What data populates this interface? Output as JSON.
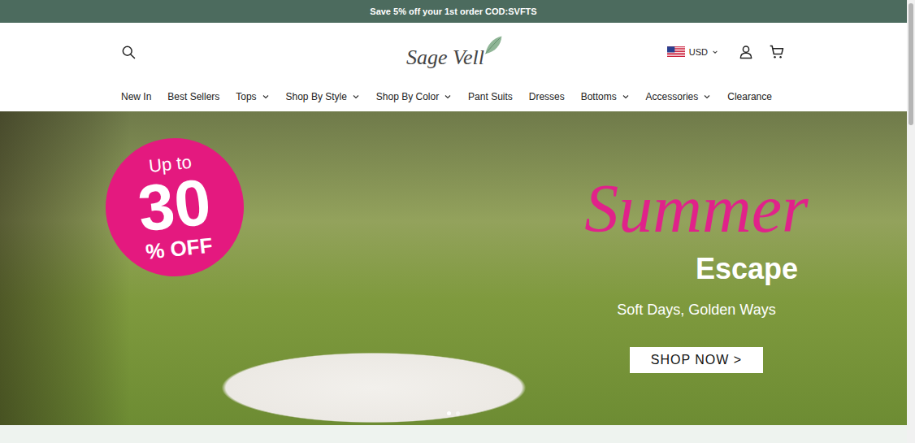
{
  "announcement": "Save 5% off your 1st order COD:SVFTS",
  "logo": {
    "text": "Sage Vell"
  },
  "currency": {
    "code": "USD"
  },
  "nav": [
    {
      "label": "New In",
      "dropdown": false
    },
    {
      "label": "Best Sellers",
      "dropdown": false
    },
    {
      "label": "Tops",
      "dropdown": true
    },
    {
      "label": "Shop By Style",
      "dropdown": true
    },
    {
      "label": "Shop By Color",
      "dropdown": true
    },
    {
      "label": "Pant Suits",
      "dropdown": false
    },
    {
      "label": "Dresses",
      "dropdown": false
    },
    {
      "label": "Bottoms",
      "dropdown": true
    },
    {
      "label": "Accessories",
      "dropdown": true
    },
    {
      "label": "Clearance",
      "dropdown": false
    }
  ],
  "hero": {
    "badge_top": "Up to",
    "badge_number": "30",
    "badge_bottom": "% OFF",
    "title": "Summer",
    "subtitle": "Escape",
    "tagline": "Soft Days, Golden Ways",
    "button": "SHOP NOW >"
  },
  "carousel_dots": [
    {
      "selected": true
    },
    {
      "selected": false
    }
  ]
}
